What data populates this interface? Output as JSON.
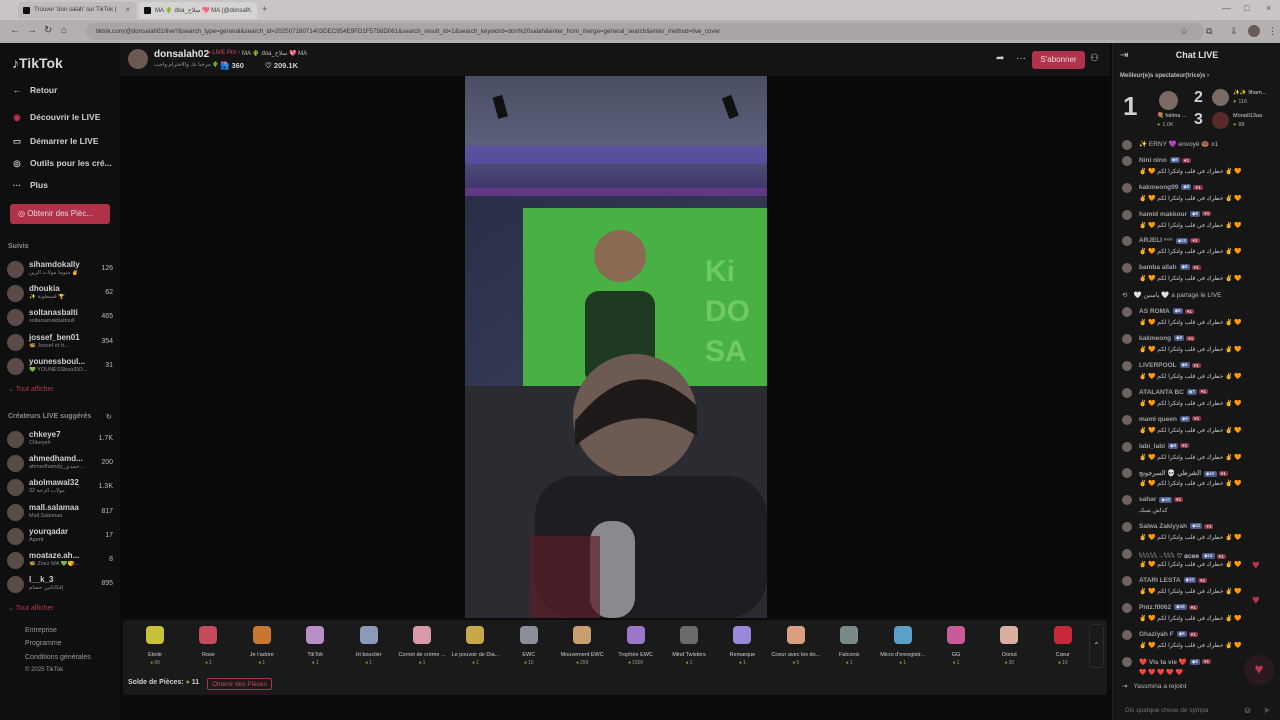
{
  "browser": {
    "tabs": [
      {
        "label": "Trouver 'don salah' sur TikTok |"
      },
      {
        "label": "MA 🌵 doa_سلاح 💖 MA (@donsal..."
      }
    ],
    "url": "tiktok.com/@donsalah02/live?&search_type=general&search_id=20250718071403DEC954E9FD1F5758D061&search_result_id=1&search_keyword=don%20salah&enter_from_merge=general_search&enter_method=live_cover"
  },
  "sidebar": {
    "logo": "TikTok",
    "back": "Retour",
    "nav": [
      {
        "label": "Découvrir le LIVE",
        "icon": "live-icon"
      },
      {
        "label": "Démarrer le LIVE",
        "icon": "camera-icon"
      },
      {
        "label": "Outils pour les cré...",
        "icon": "tools-icon"
      },
      {
        "label": "Plus",
        "icon": "more-icon"
      }
    ],
    "coins_button": "Obtenir des Pièc...",
    "followed_title": "Suivis",
    "followed": [
      {
        "name": "sihamdokally",
        "sub": "سوما مولات الزين ✌️",
        "count": "126"
      },
      {
        "name": "dhoukia",
        "sub": "✨ قسطونة 🏆",
        "count": "62"
      },
      {
        "name": "soltanasbalti",
        "sub": "soltanamakbaltoull",
        "count": "465"
      },
      {
        "name": "jossef_ben01",
        "sub": "🐝 Jossef et tt...",
        "count": "354"
      },
      {
        "name": "younessboul...",
        "sub": "💚 YOUNESSboulDO...",
        "count": "31"
      }
    ],
    "followed_show_all": "⌄ Tout afficher",
    "suggested_title": "Créateurs LIVE suggérés",
    "suggested": [
      {
        "name": "chkeye7",
        "sub": "Chkeyeh",
        "count": "1.7K"
      },
      {
        "name": "ahmedhamd...",
        "sub": "ahmedhamdy_حمدي...",
        "count": "200"
      },
      {
        "name": "abolmawal32",
        "sub": "32 مولاب الزحة",
        "count": "1.3K"
      },
      {
        "name": "mall.salamaa",
        "sub": "Mall.Salamaa",
        "count": "817"
      },
      {
        "name": "yourqadar",
        "sub": "Agent",
        "count": "17"
      },
      {
        "name": "moataze.ah...",
        "sub": "🐝 Zöez MA 💚😘...",
        "count": "8"
      },
      {
        "name": "l__k_3",
        "sub": "إفكاناتين حصام",
        "count": "895"
      }
    ],
    "suggested_show_all": "⌄ Tout afficher",
    "footer": [
      "Entreprise",
      "Programme",
      "Conditions générales",
      "© 2025 TikTok"
    ]
  },
  "header": {
    "name": "donsalah02",
    "live_badge": "● LIVE Pro ›",
    "extra": "MA 🌵 doa_سلاح 💖 MA",
    "bio": "مرحبا بك والاحترام واجب 🌵 💖",
    "viewers": "360",
    "likes": "209.1K",
    "follow_button": "S'abonner"
  },
  "gifts": [
    {
      "name": "Étoile",
      "price": "99",
      "color": "#c8c23a"
    },
    {
      "name": "Rose",
      "price": "1",
      "color": "#c54a5a"
    },
    {
      "name": "Je t'adore",
      "price": "1",
      "color": "#c9762e"
    },
    {
      "name": "TikTok",
      "price": "1",
      "color": "#b98fc8"
    },
    {
      "name": "Hi bouclier",
      "price": "1",
      "color": "#8a9ab8"
    },
    {
      "name": "Cornet de crème ...",
      "price": "1",
      "color": "#d89aa8"
    },
    {
      "name": "Le pouvoir de Dia...",
      "price": "1",
      "color": "#c8a84a"
    },
    {
      "name": "EWC",
      "price": "10",
      "color": "#8a8f9a"
    },
    {
      "name": "Mouvement EWC",
      "price": "299",
      "color": "#c8a070"
    },
    {
      "name": "Trophée EWC",
      "price": "1500",
      "color": "#9a78c8"
    },
    {
      "name": "Mind Twisters",
      "price": "1",
      "color": "#6a6a6a"
    },
    {
      "name": "Remarque",
      "price": "1",
      "color": "#9a88d8"
    },
    {
      "name": "Coeur avec les do...",
      "price": "5",
      "color": "#d8a080"
    },
    {
      "name": "Falconix",
      "price": "1",
      "color": "#7a8a8a"
    },
    {
      "name": "Micro d'enregistr...",
      "price": "1",
      "color": "#5aa0c8"
    },
    {
      "name": "GG",
      "price": "1",
      "color": "#c85a9a"
    },
    {
      "name": "Donut",
      "price": "30",
      "color": "#d8b0a0"
    },
    {
      "name": "Cœur",
      "price": "10",
      "color": "#c8283a"
    }
  ],
  "gift_footer": {
    "balance_label": "Solde de Pièces:",
    "balance": "11",
    "get_coins": "Obtenir des Pièces"
  },
  "chat": {
    "title": "Chat LIVE",
    "top_supporters": "Meilleur(e)s spectateur(trice)s ›",
    "ranking": [
      {
        "rank": "1",
        "name": "💐 fatima ...",
        "points": "1.0K"
      },
      {
        "rank": "2",
        "name": "✨✨ Ilham...",
        "points": "116"
      },
      {
        "rank": "3",
        "name": "Moradi13aa",
        "points": "88"
      }
    ],
    "first_event": "✨ ERNY 💜 envoyé 🍩 x1",
    "messages": [
      {
        "name": "Nini nino",
        "lvl": "8",
        "text": "✌️ 🧡 خطرك في قلب ولتكرا لكم ✌️ 🧡"
      },
      {
        "name": "kakmeong99",
        "lvl": "8",
        "text": "✌️ 🧡 خطرك في قلب ولتكرا لكم ✌️ 🧡"
      },
      {
        "name": "hamid makkour",
        "lvl": "8",
        "text": "✌️ 🧡 خطرك في قلب ولتكرا لكم ✌️ 🧡"
      },
      {
        "name": "ARJELI ⁶⁶⁶",
        "lvl": "10",
        "text": "✌️ 🧡 خطرك في قلب ولتكرا لكم ✌️ 🧡"
      },
      {
        "name": "bamba allah",
        "lvl": "8",
        "text": "✌️ 🧡 خطرك في قلب ولتكرا لكم ✌️ 🧡"
      }
    ],
    "share_event": "🤍 ياسين 🤍 a partagé le LIVE",
    "messages2": [
      {
        "name": "AS ROMA",
        "lvl": "8",
        "text": "✌️ 🧡 خطرك في قلب ولتكرا لكم ✌️ 🧡"
      },
      {
        "name": "kakmeong",
        "lvl": "8",
        "text": "✌️ 🧡 خطرك في قلب ولتكرا لكم ✌️ 🧡"
      },
      {
        "name": "LIVERPOOL",
        "lvl": "8",
        "text": "✌️ 🧡 خطرك في قلب ولتكرا لكم ✌️ 🧡"
      },
      {
        "name": "ATALANTA BC",
        "lvl": "7",
        "text": "✌️ 🧡 خطرك في قلب ولتكرا لكم ✌️ 🧡"
      },
      {
        "name": "mami queen",
        "lvl": "9",
        "text": "✌️ 🧡 خطرك في قلب ولتكرا لكم ✌️ 🧡"
      },
      {
        "name": "labi_labi",
        "lvl": "8",
        "text": "✌️ 🧡 خطرك في قلب ولتكرا لكم ✌️ 🧡"
      },
      {
        "name": "الشرطي 💀 السرجونج",
        "lvl": "10",
        "text": "✌️ 🧡 خطرك في قلب ولتكرا لكم ✌️ 🧡"
      },
      {
        "name": "sahar",
        "lvl": "10",
        "text": "كداش شبك"
      },
      {
        "name": "Salwa Zakiyyah",
        "lvl": "11",
        "text": "✌️ 🧡 خطرك في قلب ولتكرا لكم ✌️ 🧡"
      },
      {
        "name": "𓆩𓆩𓆩𓆩𓆩→𓆩𓆩𓆩 ♡ 𝐚𝐜𝐞𝐞",
        "lvl": "14",
        "text": "✌️ 🧡 خطرك في قلب ولتكرا لكم ✌️ 🧡"
      },
      {
        "name": "ATARI LESTA",
        "lvl": "10",
        "text": "✌️ 🧡 خطرك في قلب ولتكرا لكم ✌️ 🧡"
      },
      {
        "name": "Pntz.f0062",
        "lvl": "16",
        "text": "✌️ 🧡 خطرك في قلب ولتكرا لكم ✌️ 🧡"
      },
      {
        "name": "Ghaziyah F",
        "lvl": "9",
        "text": "✌️ 🧡 خطرك في قلب ولتكرا لكم ✌️ 🧡"
      },
      {
        "name": "❤️ Vis ta vie ❤️",
        "lvl": "6",
        "text": "❤️ ❤️ ❤️ ❤️ ❤️"
      }
    ],
    "join_event": "Yassmina a rejoint",
    "input_placeholder": "Dis quelque chose de sympa"
  }
}
